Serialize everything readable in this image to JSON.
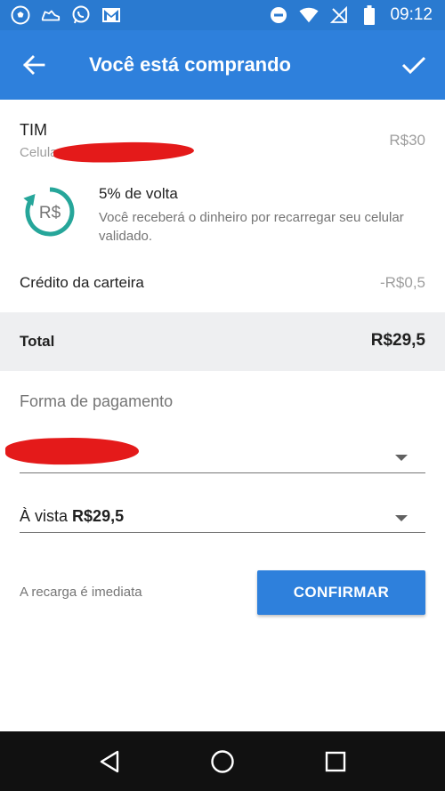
{
  "status_bar": {
    "time": "09:12",
    "left_icons": [
      "soccer-icon",
      "sneaker-icon",
      "whatsapp-icon",
      "gmail-icon"
    ],
    "right_icons": [
      "do-not-disturb-icon",
      "wifi-icon",
      "no-signal-icon",
      "battery-icon"
    ]
  },
  "app_bar": {
    "title": "Você está comprando",
    "color": "#2e80dc"
  },
  "item": {
    "name": "TIM",
    "subtitle": "Celula",
    "price": "R$30"
  },
  "cashback": {
    "icon_text": "R$",
    "title": "5% de volta",
    "description": "Você receberá o dinheiro por recarregar seu celular validado.",
    "color": "#26a69a"
  },
  "wallet": {
    "label": "Crédito da carteira",
    "value": "-R$0,5"
  },
  "total": {
    "label": "Total",
    "value": "R$29,5"
  },
  "payment": {
    "title": "Forma de pagamento",
    "method_selected": "",
    "installment_prefix": "À vista",
    "installment_value": "R$29,5"
  },
  "footer": {
    "instant_text": "A recarga é imediata",
    "confirm_label": "CONFIRMAR"
  }
}
